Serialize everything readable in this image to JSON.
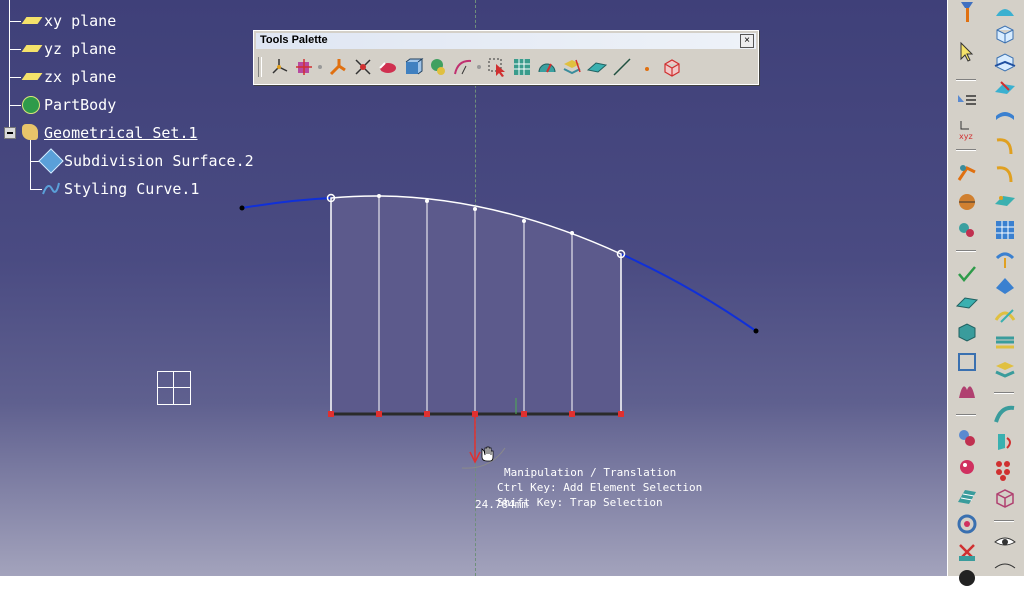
{
  "tree": {
    "items": [
      {
        "label": "xy plane",
        "icon": "plane-icon"
      },
      {
        "label": "yz plane",
        "icon": "plane-icon"
      },
      {
        "label": "zx plane",
        "icon": "plane-icon"
      },
      {
        "label": "PartBody",
        "icon": "part-body-icon"
      },
      {
        "label": "Geometrical Set.1",
        "icon": "geometrical-set-icon"
      },
      {
        "label": "Subdivision Surface.2",
        "icon": "subdivision-surface-icon"
      },
      {
        "label": "Styling Curve.1",
        "icon": "styling-curve-icon"
      }
    ]
  },
  "palette": {
    "title": "Tools Palette",
    "close": "×"
  },
  "tooltip": {
    "line1": "Manipulation / Translation",
    "line2": "Ctrl Key: Add Element Selection",
    "line3": "Shift Key: Trap Selection"
  },
  "dimension": "24.784mm",
  "colors": {
    "viewport_top": "#3f4079",
    "curve": "#1030d8",
    "surface": "#5c5a8c",
    "handles": "#e03030",
    "accent": "#f5e26a"
  }
}
